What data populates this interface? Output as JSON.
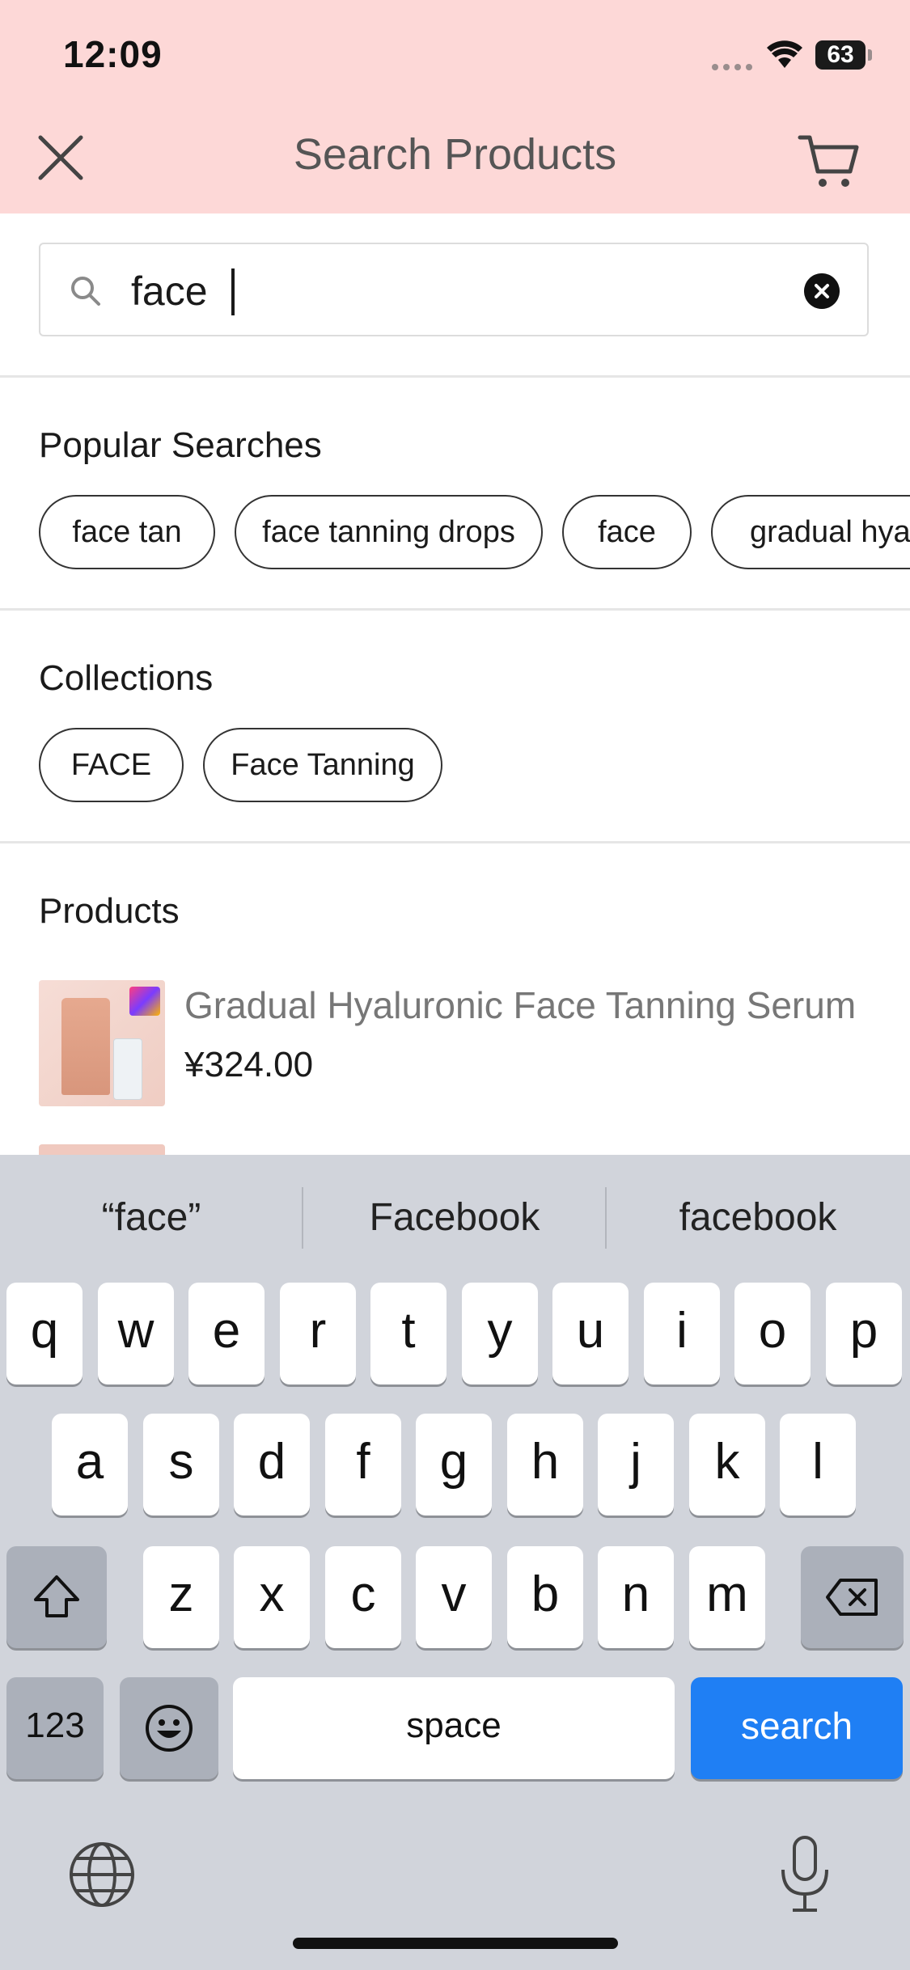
{
  "status_bar": {
    "time": "12:09",
    "battery": "63"
  },
  "header": {
    "title": "Search Products",
    "close_icon": "close-icon",
    "cart_icon": "cart-icon",
    "background": "#fdd8d7"
  },
  "search": {
    "value": "face",
    "placeholder": ""
  },
  "popular_searches": {
    "title": "Popular Searches",
    "items": [
      "face tan",
      "face tanning drops",
      "face",
      "gradual hyalu"
    ]
  },
  "collections": {
    "title": "Collections",
    "items": [
      "FACE",
      "Face Tanning"
    ]
  },
  "products": {
    "title": "Products",
    "items": [
      {
        "name": "Gradual Hyaluronic Face Tanning Serum",
        "price": "¥324.00"
      }
    ]
  },
  "keyboard": {
    "suggestions": [
      "“face”",
      "Facebook",
      "facebook"
    ],
    "row1": [
      "q",
      "w",
      "e",
      "r",
      "t",
      "y",
      "u",
      "i",
      "o",
      "p"
    ],
    "row2": [
      "a",
      "s",
      "d",
      "f",
      "g",
      "h",
      "j",
      "k",
      "l"
    ],
    "row3": [
      "z",
      "x",
      "c",
      "v",
      "b",
      "n",
      "m"
    ],
    "numbers_label": "123",
    "space_label": "space",
    "search_label": "search",
    "accent": "#1f7ff4"
  }
}
